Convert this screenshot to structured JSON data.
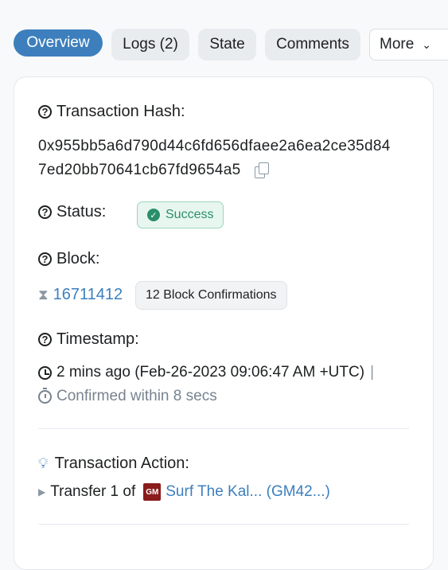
{
  "tabs": {
    "overview": "Overview",
    "logs": "Logs (2)",
    "state": "State",
    "comments": "Comments",
    "more": "More"
  },
  "tx": {
    "hash_label": "Transaction Hash:",
    "hash_line1": "0x955bb5a6d790d44c6fd656dfaee2a6ea2ce35d84",
    "hash_line2": "7ed20bb70641cb67fd9654a5",
    "status_label": "Status:",
    "status_value": "Success",
    "block_label": "Block:",
    "block_number": "16711412",
    "block_confirmations": "12 Block Confirmations",
    "timestamp_label": "Timestamp:",
    "timestamp_value": "2 mins ago (Feb-26-2023 09:06:47 AM +UTC)",
    "timestamp_sep": "|",
    "confirmed_within": "Confirmed within 8 secs",
    "action_label": "Transaction Action:",
    "action_prefix": "Transfer 1 of",
    "action_token_logo": "GM",
    "action_token": "Surf The Kal... (GM42...)"
  },
  "colors": {
    "accent": "#3d7fbd",
    "success": "#2a8f68",
    "tab_bg": "#e9ecef"
  },
  "icons": [
    "question-icon",
    "copy-icon",
    "check-icon",
    "hourglass-icon",
    "clock-icon",
    "timer-icon",
    "bulb-icon",
    "caret-right-icon",
    "chevron-down-icon"
  ]
}
